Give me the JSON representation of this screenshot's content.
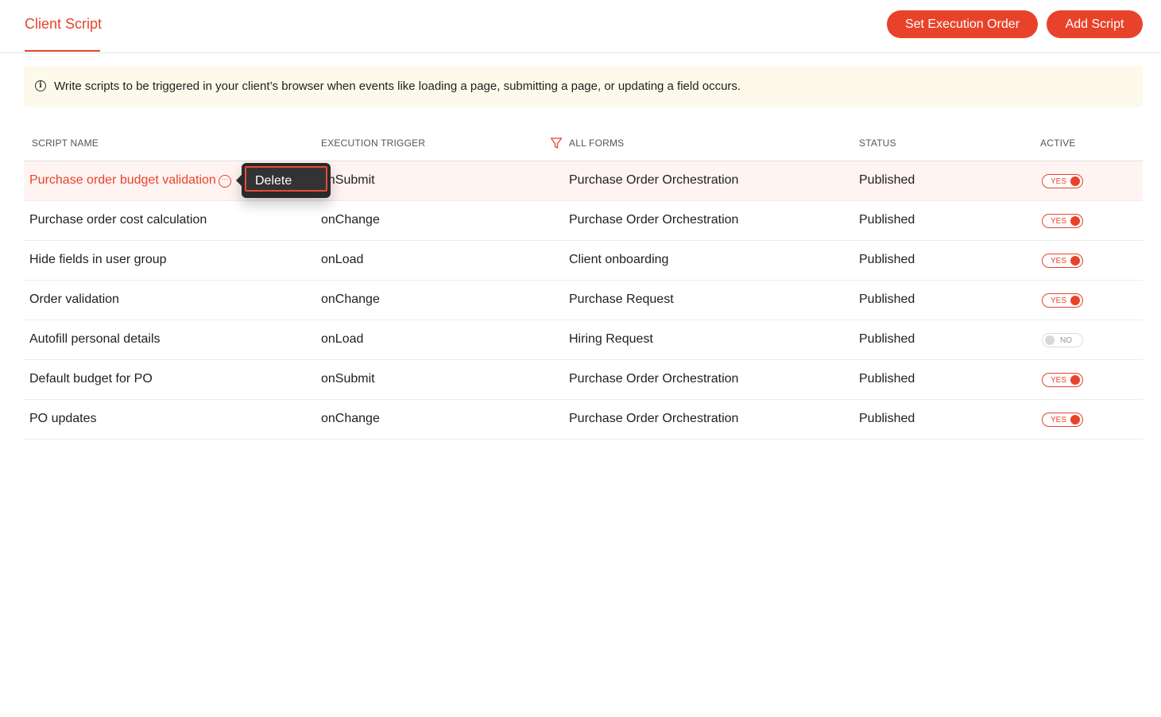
{
  "header": {
    "tab_label": "Client Script",
    "set_order_label": "Set Execution Order",
    "add_script_label": "Add Script"
  },
  "info": {
    "text": "Write scripts to be triggered in your client’s browser when events like loading a page, submitting a page, or updating a field occurs."
  },
  "table": {
    "columns": {
      "name": "SCRIPT NAME",
      "trigger": "EXECUTION TRIGGER",
      "forms": "ALL FORMS",
      "status": "STATUS",
      "active": "ACTIVE"
    },
    "rows": [
      {
        "name": "Purchase order budget validation",
        "trigger": "onSubmit",
        "form": "Purchase Order Orchestration",
        "status": "Published",
        "active": true,
        "active_label": "YES",
        "selected": true
      },
      {
        "name": "Purchase order cost calculation",
        "trigger": "onChange",
        "form": "Purchase Order Orchestration",
        "status": "Published",
        "active": true,
        "active_label": "YES"
      },
      {
        "name": "Hide fields in user group",
        "trigger": "onLoad",
        "form": "Client onboarding",
        "status": "Published",
        "active": true,
        "active_label": "YES"
      },
      {
        "name": "Order validation",
        "trigger": "onChange",
        "form": "Purchase Request",
        "status": "Published",
        "active": true,
        "active_label": "YES"
      },
      {
        "name": "Autofill personal details",
        "trigger": "onLoad",
        "form": "Hiring Request",
        "status": "Published",
        "active": false,
        "active_label": "NO"
      },
      {
        "name": "Default budget for PO",
        "trigger": "onSubmit",
        "form": "Purchase Order Orchestration",
        "status": "Published",
        "active": true,
        "active_label": "YES"
      },
      {
        "name": "PO updates",
        "trigger": "onChange",
        "form": "Purchase Order Orchestration",
        "status": "Published",
        "active": true,
        "active_label": "YES"
      }
    ]
  },
  "popover": {
    "delete_label": "Delete"
  },
  "colors": {
    "accent": "#e8432a",
    "info_bg": "#fdfaeb",
    "selected_row_bg": "#fff4f2",
    "popover_bg": "#2a2a2a"
  },
  "icons": {
    "info": "info-icon",
    "filter": "filter-icon",
    "more": "more-options-icon"
  }
}
